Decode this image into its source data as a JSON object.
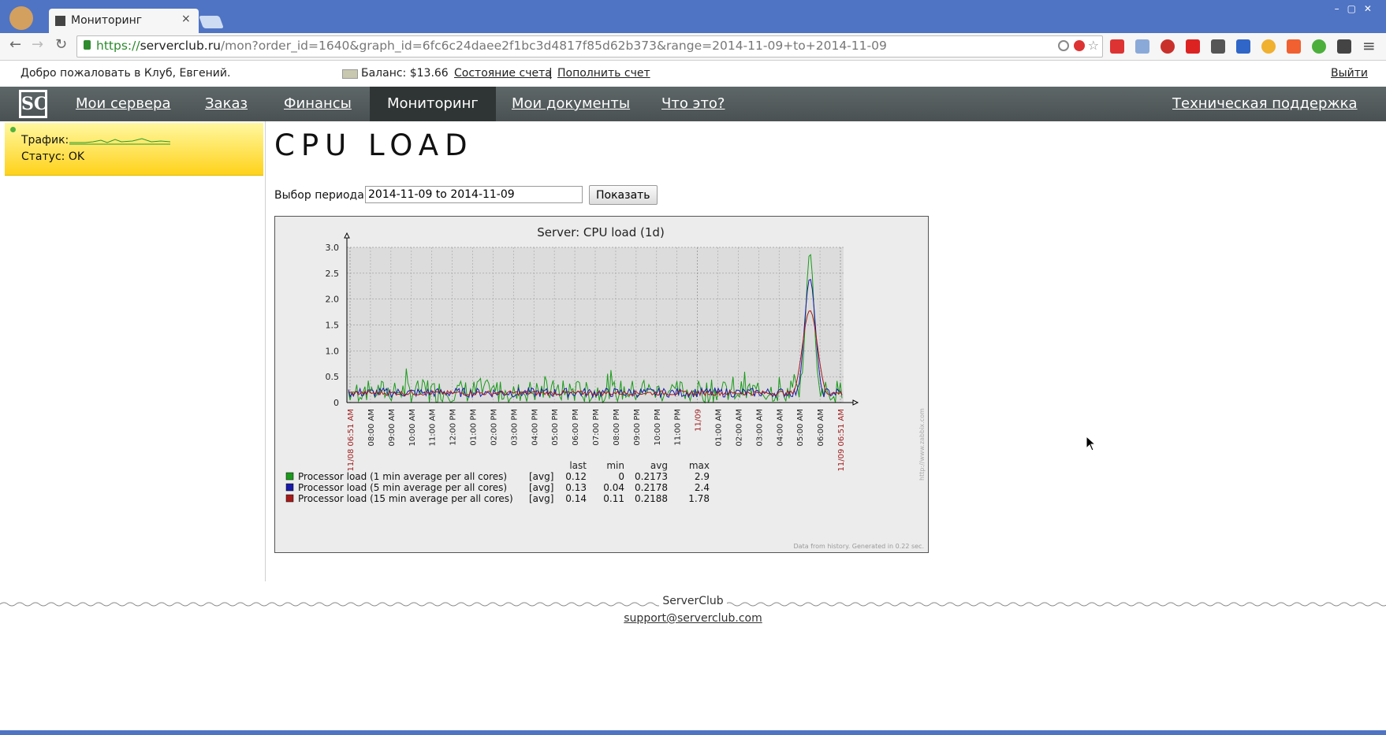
{
  "browser": {
    "tab_title": "Мониторинг",
    "tab_close": "×",
    "url_scheme": "https://",
    "url_host": "serverclub.ru",
    "url_path": "/mon?order_id=1640&graph_id=6fc6c24daee2f1bc3d4817f85d62b373&range=2014-11-09+to+2014-11-09",
    "window_controls": "–▢✕",
    "nav_back": "←",
    "nav_forward": "→",
    "nav_reload": "↻",
    "menu_icon": "≡"
  },
  "sitebar": {
    "welcome": "Добро пожаловать в Клуб, Евгений.",
    "balance": "Баланс: $13.66",
    "account_state": "Состояние счета",
    "separator": "|",
    "top_up": "Пополнить счет",
    "logout": "Выйти"
  },
  "nav": {
    "logo": "SC",
    "items": [
      "Мои сервера",
      "Заказ",
      "Финансы",
      "Мониторинг",
      "Мои документы",
      "Что это?"
    ],
    "support": "Техническая поддержка"
  },
  "sidebar": {
    "traffic_label": "Трафик:",
    "status_label": "Статус: OK"
  },
  "main": {
    "title": "CPU LOAD",
    "period_label": "Выбор периода:",
    "period_value": "2014-11-09 to 2014-11-09",
    "show_button": "Показать"
  },
  "chart_data": {
    "type": "line",
    "title": "Server: CPU load (1d)",
    "ylim": [
      0,
      3.0
    ],
    "yticks": [
      "3.0",
      "2.5",
      "2.0",
      "1.5",
      "1.0",
      "0.5",
      "0"
    ],
    "xticks": [
      "11/08 06:51 AM",
      "08:00 AM",
      "09:00 AM",
      "10:00 AM",
      "11:00 AM",
      "12:00 PM",
      "01:00 PM",
      "02:00 PM",
      "03:00 PM",
      "04:00 PM",
      "05:00 PM",
      "06:00 PM",
      "07:00 PM",
      "08:00 PM",
      "09:00 PM",
      "10:00 PM",
      "11:00 PM",
      "11/09",
      "01:00 AM",
      "02:00 AM",
      "03:00 AM",
      "04:00 AM",
      "05:00 AM",
      "06:00 AM",
      "11/09 06:51 AM"
    ],
    "grid": true,
    "series": [
      {
        "name": "Processor load (1 min average per all cores)",
        "color": "#1a9a1a",
        "agg": "[avg]",
        "last": "0.12",
        "min": "0",
        "avg": "0.2173",
        "max": "2.9"
      },
      {
        "name": "Processor load (5 min average per all cores)",
        "color": "#1a1aa8",
        "agg": "[avg]",
        "last": "0.13",
        "min": "0.04",
        "avg": "0.2178",
        "max": "2.4"
      },
      {
        "name": "Processor load (15 min average per all cores)",
        "color": "#a81a1a",
        "agg": "[avg]",
        "last": "0.14",
        "min": "0.11",
        "avg": "0.2188",
        "max": "1.78"
      }
    ],
    "legend_headers": [
      "last",
      "min",
      "avg",
      "max"
    ],
    "footnote": "Data from history. Generated in 0.22 sec.",
    "watermark": "http://www.zabbix.com"
  },
  "footer": {
    "name": "ServerClub",
    "email": "support@serverclub.com"
  }
}
